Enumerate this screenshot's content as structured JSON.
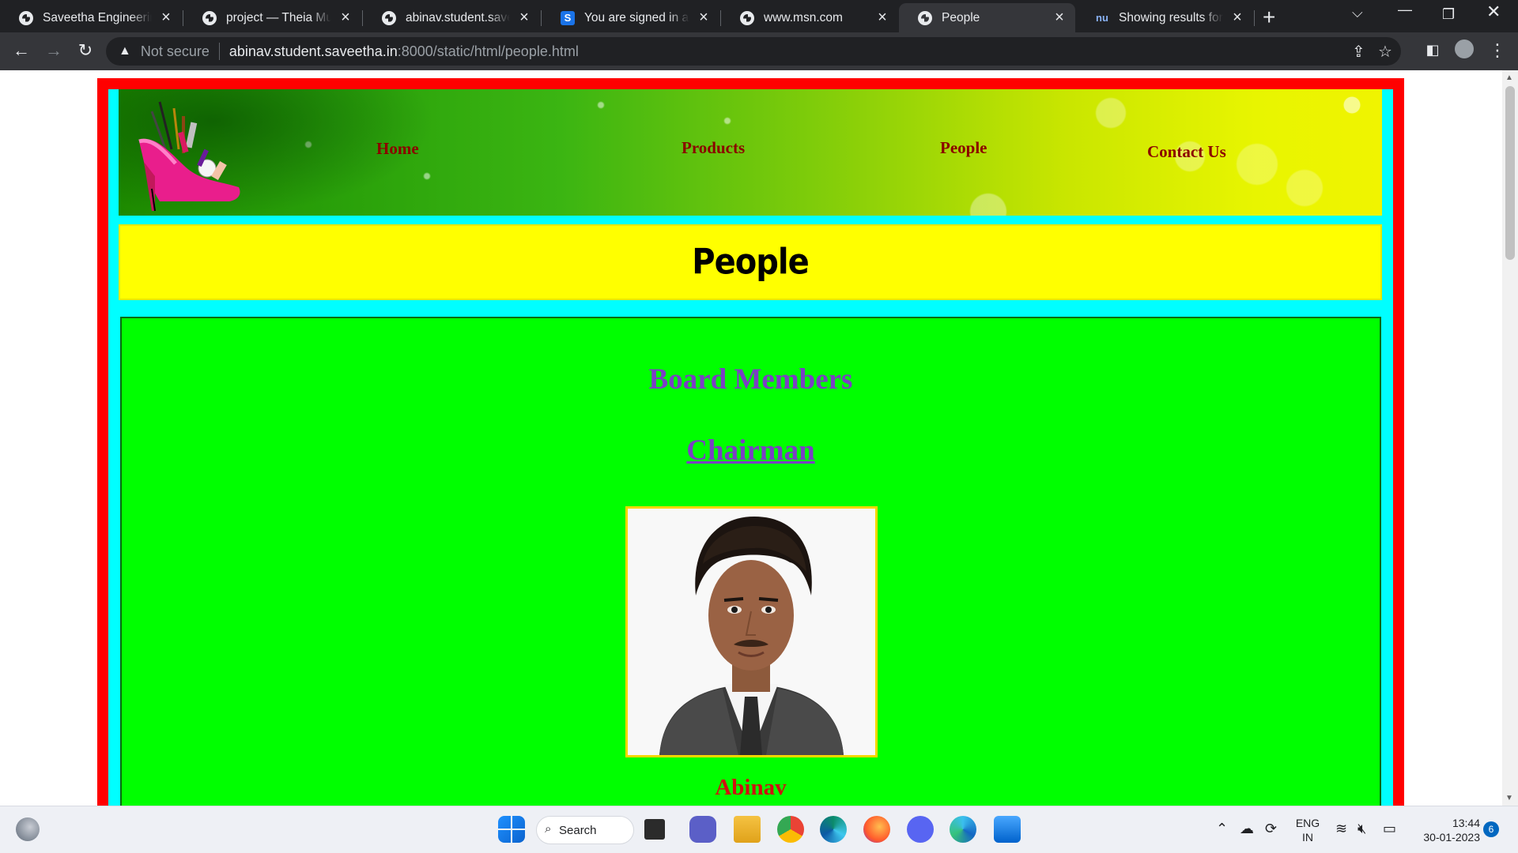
{
  "browser": {
    "tabs": [
      {
        "title": "Saveetha Engineering",
        "favicon": "globe-icon",
        "active": false
      },
      {
        "title": "project — Theia Multi",
        "favicon": "globe-icon",
        "active": false
      },
      {
        "title": "abinav.student.saveetha",
        "favicon": "globe-icon",
        "active": false
      },
      {
        "title": "You are signed in as 2",
        "favicon": "s-icon",
        "active": false
      },
      {
        "title": "www.msn.com",
        "favicon": "globe-icon",
        "active": false
      },
      {
        "title": "People",
        "favicon": "globe-icon",
        "active": true
      },
      {
        "title": "Showing results for ht",
        "favicon": "nu-icon",
        "active": false
      }
    ],
    "new_tab_label": "+",
    "security_label": "Not secure",
    "url_host": "abinav.student.saveetha.in",
    "url_path": ":8000/static/html/people.html"
  },
  "page": {
    "nav": {
      "home": "Home",
      "products": "Products",
      "people": "People",
      "contact": "Contact Us"
    },
    "title": "People",
    "section_heading": "Board Members",
    "role_heading": "Chairman",
    "person_name": "Abinav"
  },
  "colors": {
    "outer_border": "#ff0000",
    "inner_border": "#00ffff",
    "title_box": "#ffff00",
    "content_bg": "#00ff00",
    "nav_text": "#8b0000",
    "heading_text": "#7b3fc4",
    "name_text": "#d01010"
  },
  "taskbar": {
    "search_label": "Search",
    "lang_top": "ENG",
    "lang_bottom": "IN",
    "time": "13:44",
    "date": "30-01-2023",
    "notification_count": "6"
  }
}
